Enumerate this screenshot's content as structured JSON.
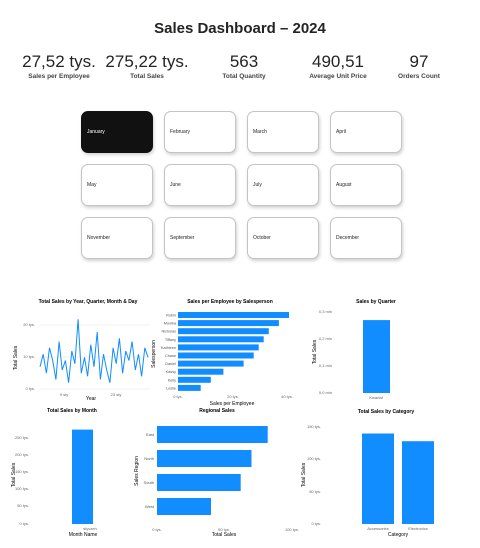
{
  "page": {
    "title": "Sales Dashboard – 2024"
  },
  "kpis": [
    {
      "value": "27,52 tys.",
      "label": "Sales per Employee"
    },
    {
      "value": "275,22 tys.",
      "label": "Total Sales"
    },
    {
      "value": "563",
      "label": "Total Quantity"
    },
    {
      "value": "490,51",
      "label": "Average Unit Price"
    },
    {
      "value": "97",
      "label": "Orders Count"
    }
  ],
  "months": {
    "selected": "January",
    "items": [
      "January",
      "February",
      "March",
      "April",
      "May",
      "June",
      "July",
      "August",
      "November",
      "September",
      "October",
      "December"
    ]
  },
  "colors": {
    "bar": "#118dff",
    "selected_tile": "#111111"
  },
  "chart_data": [
    {
      "type": "line",
      "title": "Total Sales by Year, Quarter, Month & Day",
      "xlabel": "Year",
      "ylabel": "Total Sales",
      "xticks": [
        "9 sty",
        "23 sty"
      ],
      "yticks": [
        "0 tys.",
        "10 tys.",
        "20 tys."
      ],
      "ylim": [
        0,
        24
      ],
      "values": [
        7,
        11,
        5,
        13,
        9,
        3,
        15,
        6,
        9,
        2,
        12,
        8,
        22,
        5,
        10,
        4,
        14,
        7,
        18,
        3,
        11,
        6,
        2,
        13,
        8,
        16,
        5,
        12,
        9,
        15,
        6,
        11,
        4,
        13,
        10
      ]
    },
    {
      "type": "bar",
      "orientation": "horizontal",
      "title": "Sales per Employee by Salesperson",
      "xlabel": "Sales per Employee",
      "ylabel": "Salesperson",
      "categories": [
        "Robin",
        "Monika",
        "Nicholas",
        "Tiffany",
        "Kathleen",
        "Chase",
        "Daniel",
        "Kassy",
        "Kelly",
        "Leslie"
      ],
      "values": [
        44,
        40,
        36,
        34,
        32,
        30,
        26,
        18,
        13,
        9
      ],
      "xticks": [
        "0 tys.",
        "20 tys.",
        "40 tys."
      ],
      "xlim": [
        0,
        46
      ]
    },
    {
      "type": "bar",
      "title": "Sales by Quarter",
      "xlabel": "",
      "ylabel": "Total Sales",
      "categories": [
        "Kwartał"
      ],
      "values": [
        0.27
      ],
      "yticks": [
        "0,0 mln",
        "0,1 mln",
        "0,2 mln",
        "0,3 mln"
      ],
      "ylim": [
        0,
        0.3
      ]
    },
    {
      "type": "bar",
      "title": "Total Sales by Month",
      "xlabel": "Month Name",
      "ylabel": "Total Sales",
      "categories": [
        "styczeń"
      ],
      "values": [
        275
      ],
      "yticks": [
        "0 tys.",
        "50 tys.",
        "100 tys.",
        "150 tys.",
        "200 tys.",
        "250 tys."
      ],
      "ylim": [
        0,
        300
      ]
    },
    {
      "type": "bar",
      "orientation": "horizontal",
      "title": "Regional Sales",
      "xlabel": "Total Sales",
      "ylabel": "Sales Region",
      "categories": [
        "East",
        "North",
        "South",
        "West"
      ],
      "values": [
        82,
        70,
        62,
        40
      ],
      "xticks": [
        "0 tys.",
        "50 tys.",
        "100 tys."
      ],
      "xlim": [
        0,
        100
      ]
    },
    {
      "type": "bar",
      "title": "Total Sales by Category",
      "xlabel": "Category",
      "ylabel": "Total Sales",
      "categories": [
        "Accessories",
        "Electronics"
      ],
      "values": [
        140,
        128
      ],
      "yticks": [
        "0 tys.",
        "50 tys.",
        "100 tys.",
        "150 tys."
      ],
      "ylim": [
        0,
        150
      ]
    }
  ]
}
